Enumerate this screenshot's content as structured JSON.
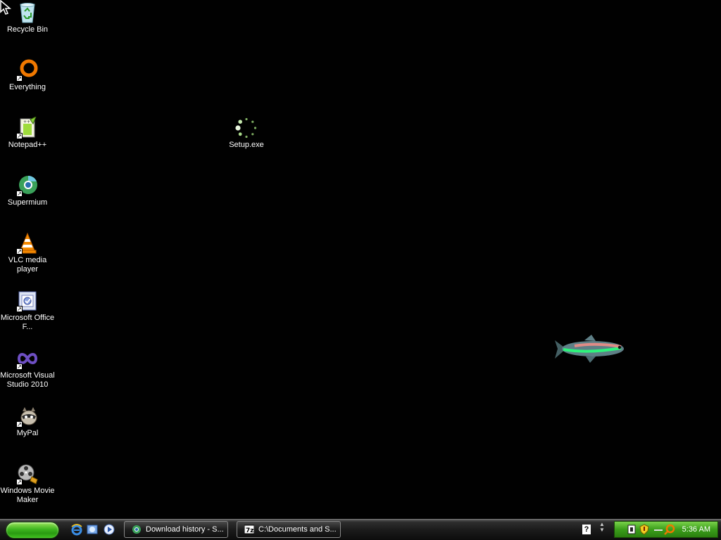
{
  "desktop": {
    "icons": [
      {
        "label": "Recycle Bin",
        "icon": "recycle-bin-icon"
      },
      {
        "label": "Everything",
        "icon": "everything-search-icon"
      },
      {
        "label": "Notepad++",
        "icon": "notepad-plus-plus-icon"
      },
      {
        "label": "Supermium",
        "icon": "supermium-browser-icon"
      },
      {
        "label": "VLC media player",
        "icon": "vlc-cone-icon"
      },
      {
        "label": "Microsoft Office F...",
        "icon": "office-file-validation-icon"
      },
      {
        "label": "Microsoft Visual Studio 2010",
        "icon": "visual-studio-icon"
      },
      {
        "label": "MyPal",
        "icon": "mypal-raccoon-icon"
      },
      {
        "label": "Windows Movie Maker",
        "icon": "movie-maker-icon"
      },
      {
        "label": "Setup.exe",
        "icon": "loading-spinner-icon"
      }
    ]
  },
  "taskbar": {
    "start_label": "",
    "quick_launch": [
      "internet-explorer-icon",
      "show-desktop-icon",
      "media-player-icon"
    ],
    "tasks": [
      {
        "label": "Download history - S...",
        "icon": "supermium-browser-icon"
      },
      {
        "label": "C:\\Documents and S...",
        "icon": "7zip-icon"
      }
    ],
    "help_glyph": "?",
    "clock": "5:36 AM"
  },
  "colors": {
    "desktop_bg": "#010101",
    "start_green": "#3db51f",
    "tray_green": "#3b9e1b"
  }
}
